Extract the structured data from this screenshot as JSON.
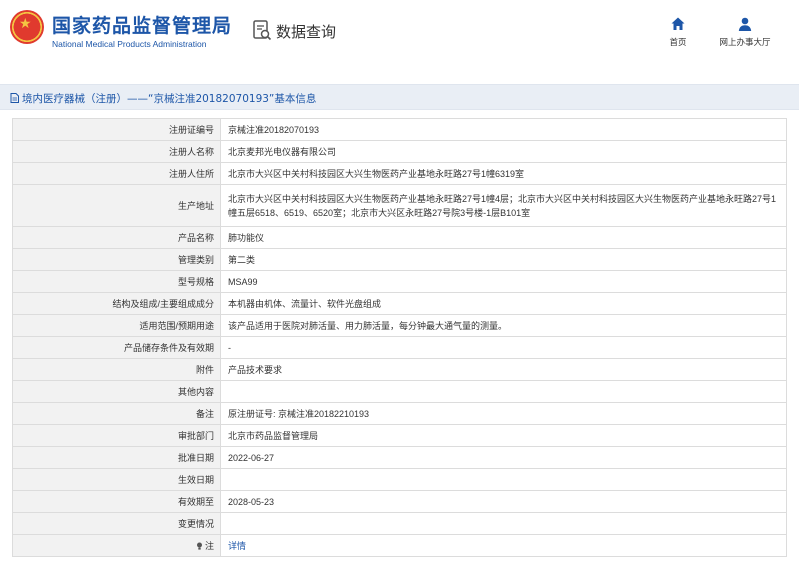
{
  "header": {
    "title": "国家药品监督管理局",
    "subtitle": "National Medical Products Administration",
    "query_label": "数据查询",
    "nav": [
      {
        "label": "首页",
        "icon": "home-icon"
      },
      {
        "label": "网上办事大厅",
        "icon": "user-icon"
      }
    ]
  },
  "breadcrumb": {
    "text": "境内医疗器械（注册）——“京械注准20182070193”基本信息"
  },
  "colors": {
    "brand_blue": "#1d56a8",
    "label_bg": "#f2f2f2",
    "crumb_bg": "#e9eef5",
    "emblem_red": "#e03a2e"
  },
  "details": [
    {
      "label": "注册证编号",
      "value": "京械注准20182070193"
    },
    {
      "label": "注册人名称",
      "value": "北京麦邦光电仪器有限公司"
    },
    {
      "label": "注册人住所",
      "value": "北京市大兴区中关村科技园区大兴生物医药产业基地永旺路27号1幢6319室"
    },
    {
      "label": "生产地址",
      "value": "北京市大兴区中关村科技园区大兴生物医药产业基地永旺路27号1幢4层；北京市大兴区中关村科技园区大兴生物医药产业基地永旺路27号1幢五层6518、6519、6520室；北京市大兴区永旺路27号院3号楼-1层B101室"
    },
    {
      "label": "产品名称",
      "value": "肺功能仪"
    },
    {
      "label": "管理类别",
      "value": "第二类"
    },
    {
      "label": "型号规格",
      "value": "MSA99"
    },
    {
      "label": "结构及组成/主要组成成分",
      "value": "本机器由机体、流量计、软件光盘组成"
    },
    {
      "label": "适用范围/预期用途",
      "value": "该产品适用于医院对肺活量、用力肺活量，每分钟最大通气量的测量。"
    },
    {
      "label": "产品储存条件及有效期",
      "value": "-"
    },
    {
      "label": "附件",
      "value": "产品技术要求"
    },
    {
      "label": "其他内容",
      "value": ""
    },
    {
      "label": "备注",
      "value": "原注册证号: 京械注准20182210193"
    },
    {
      "label": "审批部门",
      "value": "北京市药品监督管理局"
    },
    {
      "label": "批准日期",
      "value": "2022-06-27"
    },
    {
      "label": "生效日期",
      "value": ""
    },
    {
      "label": "有效期至",
      "value": "2028-05-23"
    },
    {
      "label": "变更情况",
      "value": ""
    },
    {
      "label": "注",
      "value": "详情"
    }
  ]
}
